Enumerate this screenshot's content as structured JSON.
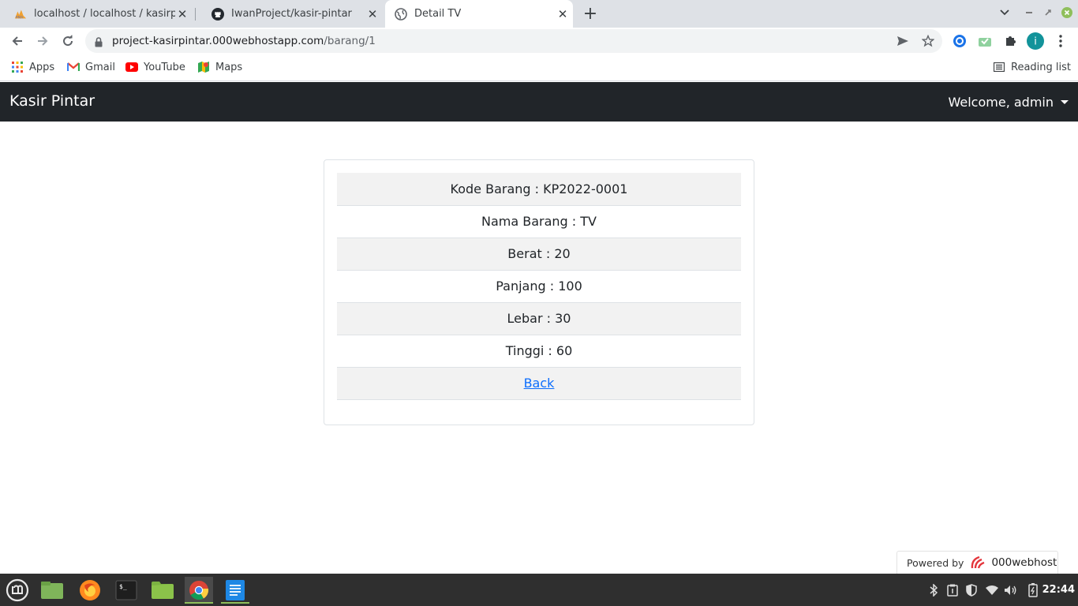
{
  "browser": {
    "tabs": [
      {
        "title": "localhost / localhost / kasirpintar",
        "icon": "phpmyadmin-icon"
      },
      {
        "title": "IwanProject/kasir-pintar",
        "icon": "github-icon"
      },
      {
        "title": "Detail TV",
        "icon": "globe-icon",
        "active": true
      }
    ],
    "url_host": "project-kasirpintar.000webhostapp.com",
    "url_path": "/barang/1",
    "profile_initial": "i",
    "bookmarks": [
      {
        "label": "Apps",
        "icon": "apps-grid-icon"
      },
      {
        "label": "Gmail",
        "icon": "gmail-icon"
      },
      {
        "label": "YouTube",
        "icon": "youtube-icon"
      },
      {
        "label": "Maps",
        "icon": "maps-icon"
      }
    ],
    "reading_list": "Reading list"
  },
  "navbar": {
    "brand": "Kasir Pintar",
    "welcome": "Welcome, admin"
  },
  "detail": {
    "rows": [
      "Kode Barang : KP2022-0001",
      "Nama Barang : TV",
      "Berat : 20",
      "Panjang : 100",
      "Lebar : 30",
      "Tinggi : 60"
    ],
    "back_label": "Back"
  },
  "footer": {
    "powered_by": "Powered by",
    "host_name": "000webhost"
  },
  "taskbar": {
    "time": "22:44",
    "apps": [
      "mint-menu-icon",
      "show-desktop-icon",
      "firefox-icon",
      "terminal-icon",
      "files-icon",
      "chrome-icon",
      "text-editor-icon"
    ]
  },
  "colors": {
    "navbar_bg": "#212529",
    "row_stripe": "#f2f2f2",
    "link": "#0d6efd"
  }
}
